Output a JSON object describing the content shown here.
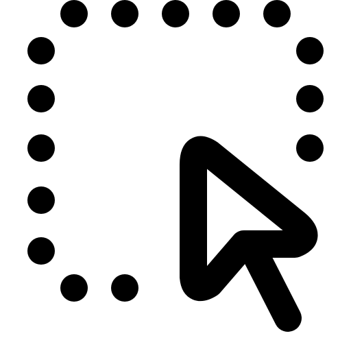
{
  "icon": {
    "name": "select-area-pointer-icon",
    "foreground_color": "#000000",
    "background_color": "#ffffff",
    "parts": [
      "dotted-selection-square",
      "cursor-arrow"
    ]
  }
}
